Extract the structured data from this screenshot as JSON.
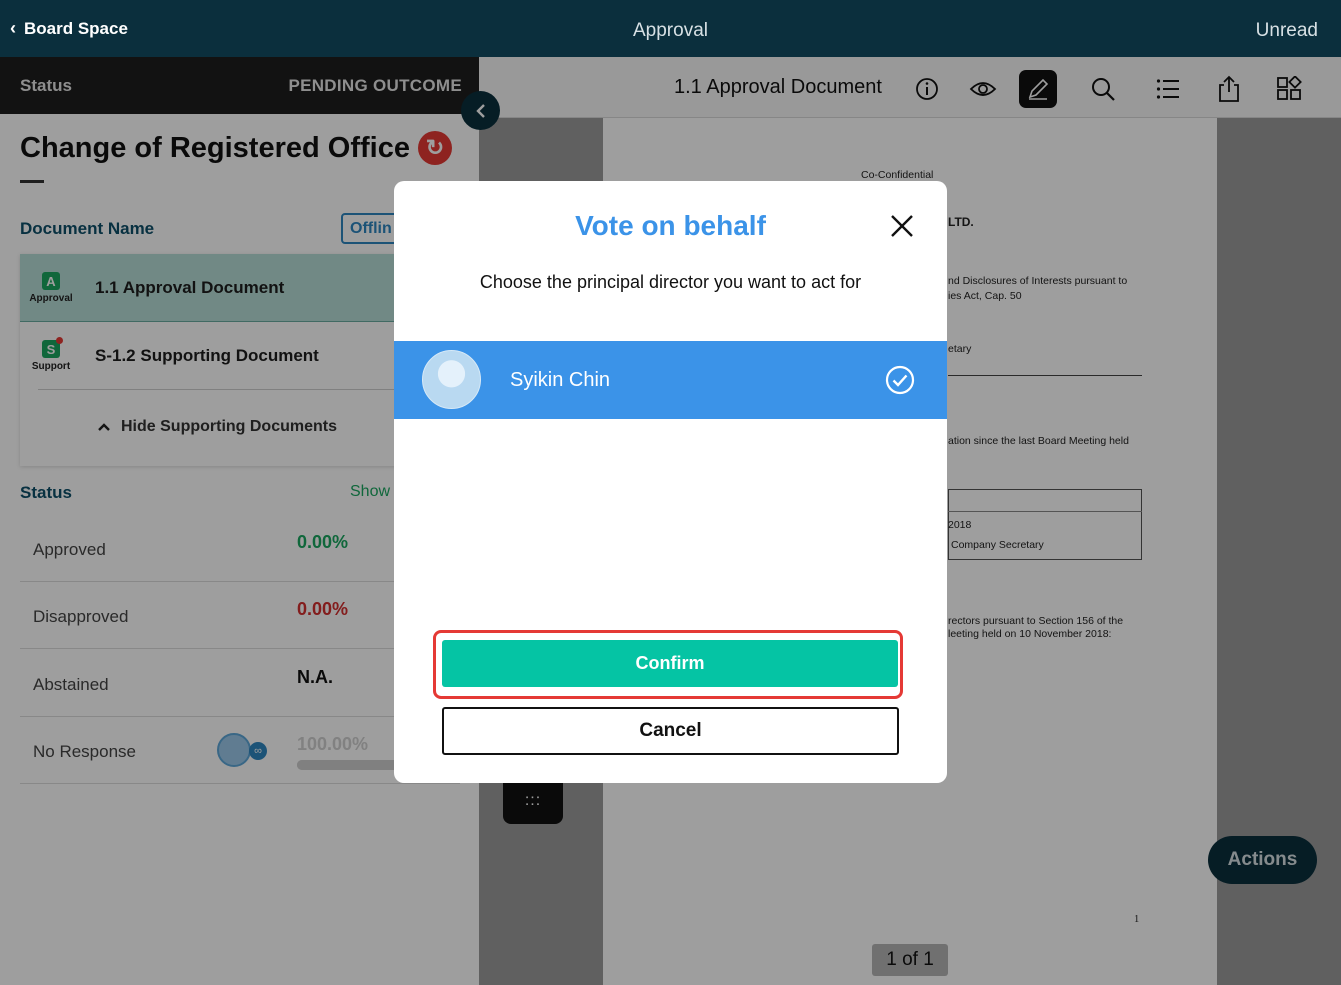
{
  "header": {
    "back_label": "Board Space",
    "title": "Approval",
    "right_label": "Unread"
  },
  "left_panel": {
    "status_key": "Status",
    "status_value": "PENDING OUTCOME",
    "title": "Change of Registered Office",
    "document_name_label": "Document Name",
    "offline_label": "Offlin",
    "documents": [
      {
        "badge": "A",
        "badge_caption": "Approval",
        "title": "1.1 Approval Document"
      },
      {
        "badge": "S",
        "badge_caption": "Support",
        "title": "S-1.2 Supporting Document"
      }
    ],
    "hide_supporting_label": "Hide Supporting Documents",
    "status_section_label": "Status",
    "show_label": "Show",
    "stats": [
      {
        "name": "Approved",
        "value": "0.00%"
      },
      {
        "name": "Disapproved",
        "value": "0.00%"
      },
      {
        "name": "Abstained",
        "value": "N.A."
      },
      {
        "name": "No Response",
        "value": "100.00%",
        "progress": 1.0
      }
    ]
  },
  "viewer": {
    "document_title": "1.1 Approval Document",
    "tools": [
      "info-icon",
      "eye-icon",
      "pen-icon",
      "search-icon",
      "list-icon",
      "share-icon",
      "grid-icon"
    ],
    "page_text": {
      "confidential": "Co-Confidential",
      "ltd": "LTD.",
      "disclosures_1": "nd Disclosures of Interests pursuant to",
      "disclosures_2": "ies Act, Cap. 50",
      "secretary": "etary",
      "since_meeting": "ation since the last Board Meeting held",
      "year": "2018",
      "company_secretary": "Company Secretary",
      "directors_1": "rectors pursuant to Section 156 of the",
      "directors_2": "leeting held on 10 November 2018:",
      "footer_number": "1"
    },
    "page_indicator": "1 of 1",
    "thumb_dots": ":::",
    "actions_label": "Actions"
  },
  "modal": {
    "title": "Vote on behalf",
    "subtitle": "Choose the principal director you want to act for",
    "director_name": "Syikin Chin",
    "confirm_label": "Confirm",
    "cancel_label": "Cancel"
  },
  "colors": {
    "navy": "#0b2f3d",
    "accent_blue": "#3b93e8",
    "confirm_green": "#05c4a4",
    "highlight_red": "#e53935",
    "approved_green": "#1aa760",
    "disapproved_red": "#d32f2f"
  }
}
